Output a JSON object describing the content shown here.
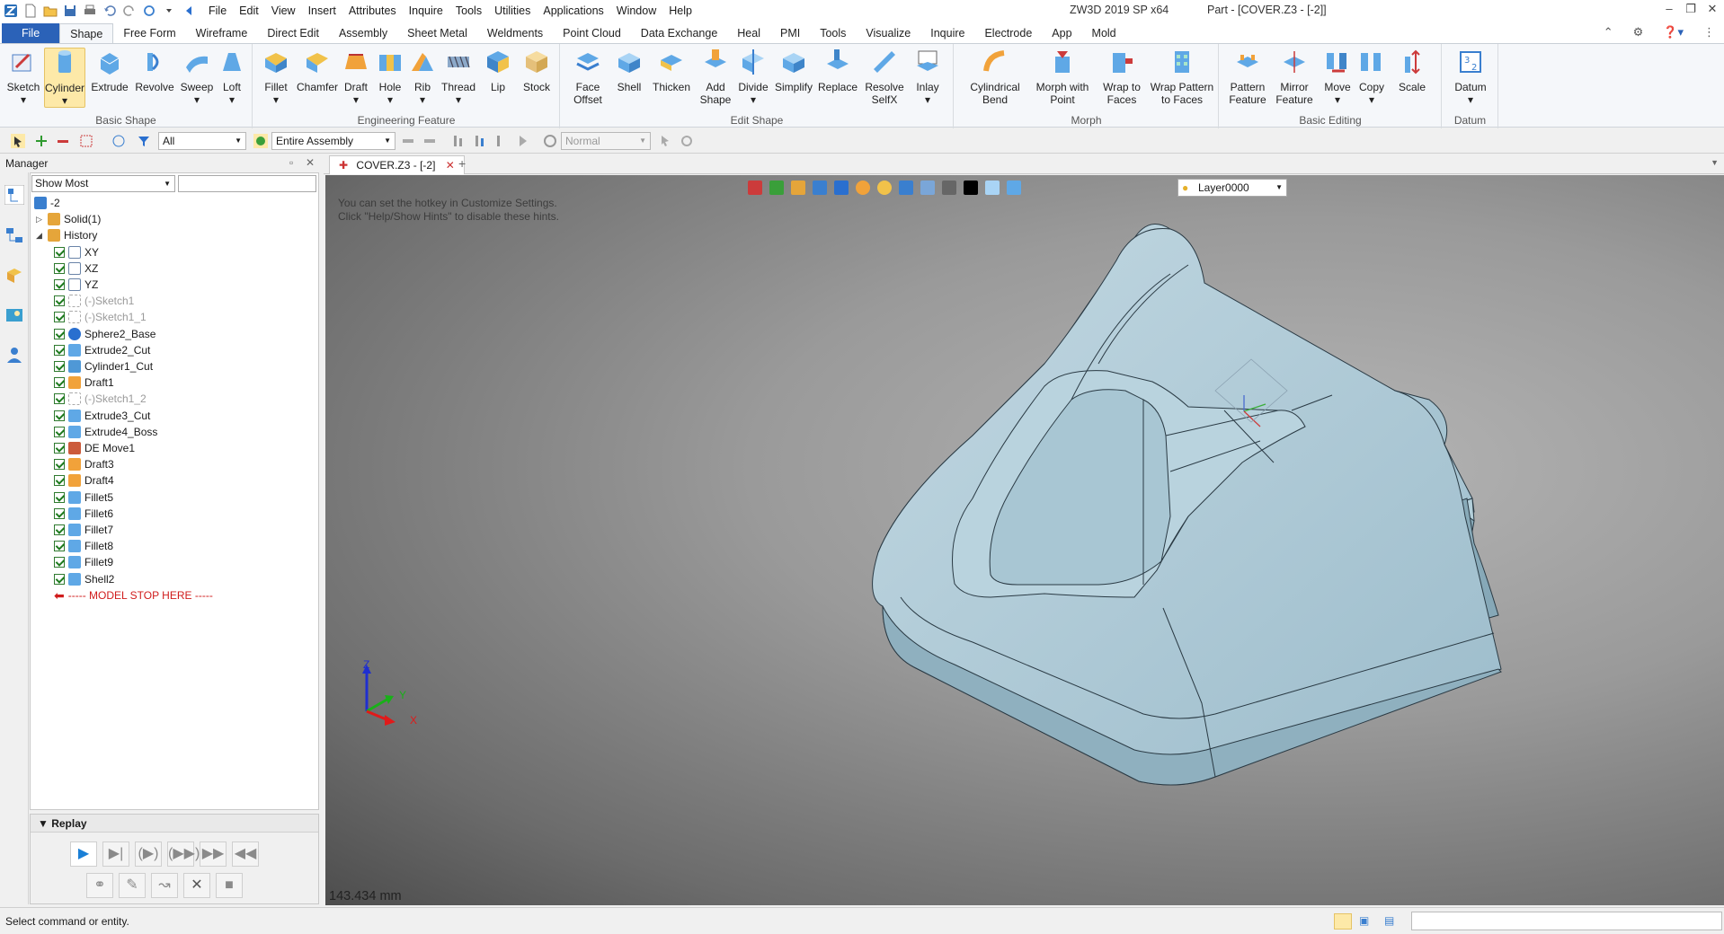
{
  "menu": [
    "File",
    "Edit",
    "View",
    "Insert",
    "Attributes",
    "Inquire",
    "Tools",
    "Utilities",
    "Applications",
    "Window",
    "Help"
  ],
  "app_title": "ZW3D 2019 SP x64",
  "part_title": "Part - [COVER.Z3 - [-2]]",
  "ribbon_tabs": [
    "File",
    "Shape",
    "Free Form",
    "Wireframe",
    "Direct Edit",
    "Assembly",
    "Sheet Metal",
    "Weldments",
    "Point Cloud",
    "Data Exchange",
    "Heal",
    "PMI",
    "Tools",
    "Visualize",
    "Inquire",
    "Electrode",
    "App",
    "Mold"
  ],
  "ribbon": {
    "basic_shape": {
      "label": "Basic Shape",
      "buttons": [
        "Sketch",
        "Cylinder",
        "Extrude",
        "Revolve",
        "Sweep",
        "Loft"
      ]
    },
    "engineering": {
      "label": "Engineering Feature",
      "buttons": [
        "Fillet",
        "Chamfer",
        "Draft",
        "Hole",
        "Rib",
        "Thread",
        "Lip",
        "Stock"
      ]
    },
    "edit_shape": {
      "label": "Edit Shape",
      "buttons": [
        "Face\nOffset",
        "Shell",
        "Thicken",
        "Add\nShape",
        "Divide",
        "Simplify",
        "Replace",
        "Resolve\nSelfX",
        "Inlay"
      ]
    },
    "morph": {
      "label": "Morph",
      "buttons": [
        "Cylindrical\nBend",
        "Morph with\nPoint",
        "Wrap to\nFaces",
        "Wrap Pattern\nto Faces"
      ]
    },
    "basic_editing": {
      "label": "Basic Editing",
      "buttons": [
        "Pattern\nFeature",
        "Mirror\nFeature",
        "Move",
        "Copy",
        "Scale"
      ]
    },
    "datum": {
      "label": "Datum",
      "buttons": [
        "Datum"
      ]
    }
  },
  "toolbar": {
    "filter": "All",
    "scope": "Entire Assembly",
    "mode": "Normal"
  },
  "manager": {
    "title": "Manager",
    "view_filter": "Show Most"
  },
  "tree": [
    {
      "name": "-2",
      "level": 0,
      "icon": "assembly-icon",
      "type": "root"
    },
    {
      "name": "Solid(1)",
      "level": 1,
      "icon": "folder-icon",
      "type": "folder",
      "expander": "+"
    },
    {
      "name": "History",
      "level": 1,
      "icon": "folder-icon",
      "type": "folder",
      "expander": "-"
    },
    {
      "name": "XY",
      "level": 2,
      "icon": "plane-icon",
      "type": "item"
    },
    {
      "name": "XZ",
      "level": 2,
      "icon": "plane-icon",
      "type": "item"
    },
    {
      "name": "YZ",
      "level": 2,
      "icon": "plane-icon",
      "type": "item"
    },
    {
      "name": "(-)Sketch1",
      "level": 2,
      "icon": "sketch-icon",
      "type": "suppressed"
    },
    {
      "name": "(-)Sketch1_1",
      "level": 2,
      "icon": "sketch-icon",
      "type": "suppressed"
    },
    {
      "name": "Sphere2_Base",
      "level": 2,
      "icon": "sphere-icon",
      "type": "item"
    },
    {
      "name": "Extrude2_Cut",
      "level": 2,
      "icon": "extrude-icon",
      "type": "item"
    },
    {
      "name": "Cylinder1_Cut",
      "level": 2,
      "icon": "cylinder-icon",
      "type": "item"
    },
    {
      "name": "Draft1",
      "level": 2,
      "icon": "draft-icon",
      "type": "item"
    },
    {
      "name": "(-)Sketch1_2",
      "level": 2,
      "icon": "sketch-icon",
      "type": "suppressed"
    },
    {
      "name": "Extrude3_Cut",
      "level": 2,
      "icon": "extrude-icon",
      "type": "item"
    },
    {
      "name": "Extrude4_Boss",
      "level": 2,
      "icon": "extrude-icon",
      "type": "item"
    },
    {
      "name": "DE Move1",
      "level": 2,
      "icon": "move-icon",
      "type": "item"
    },
    {
      "name": "Draft3",
      "level": 2,
      "icon": "draft-icon",
      "type": "item"
    },
    {
      "name": "Draft4",
      "level": 2,
      "icon": "draft-icon",
      "type": "item"
    },
    {
      "name": "Fillet5",
      "level": 2,
      "icon": "fillet-icon",
      "type": "item"
    },
    {
      "name": "Fillet6",
      "level": 2,
      "icon": "fillet-icon",
      "type": "item"
    },
    {
      "name": "Fillet7",
      "level": 2,
      "icon": "fillet-icon",
      "type": "item"
    },
    {
      "name": "Fillet8",
      "level": 2,
      "icon": "fillet-icon",
      "type": "item"
    },
    {
      "name": "Fillet9",
      "level": 2,
      "icon": "fillet-icon",
      "type": "item"
    },
    {
      "name": "Shell2",
      "level": 2,
      "icon": "shell-icon",
      "type": "item"
    },
    {
      "name": "----- MODEL STOP HERE -----",
      "level": 2,
      "icon": "arrow-left-icon",
      "type": "stop"
    }
  ],
  "replay": {
    "title": "Replay"
  },
  "doc_tab": "COVER.Z3 - [-2]",
  "viewport": {
    "hint_line1": "You can set the hotkey in Customize Settings.",
    "hint_line2": "Click \"Help/Show Hints\" to disable these hints.",
    "layer": "Layer0000",
    "measure": "143.434 mm",
    "axis_x": "X",
    "axis_y": "Y",
    "axis_z": "Z"
  },
  "status": "Select command or entity.",
  "colors": {
    "accent": "#2b62b8",
    "model": "#a9c7d3",
    "stop": "#d01c1c"
  }
}
